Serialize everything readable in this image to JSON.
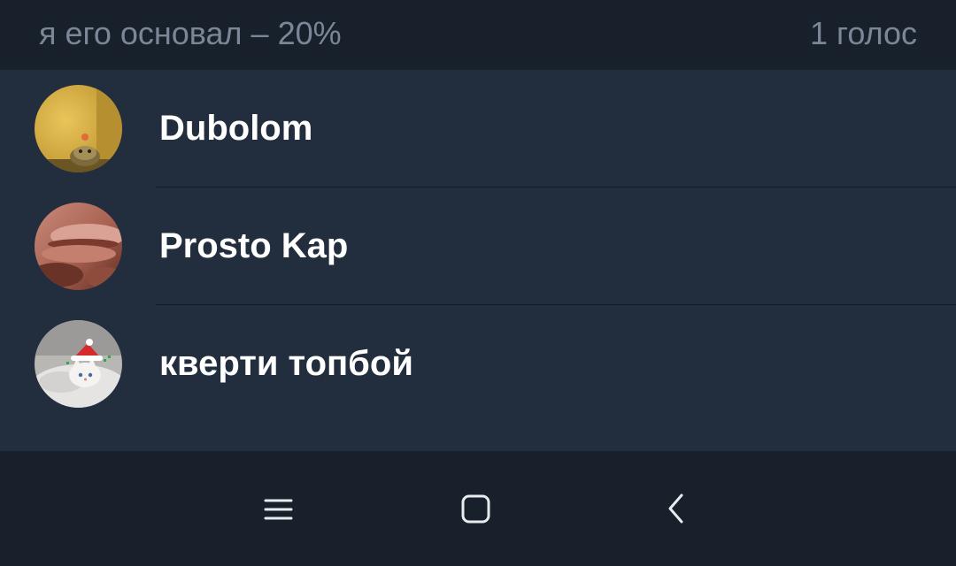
{
  "poll_option": {
    "title": "я его основал – 20%",
    "votes": "1 голос"
  },
  "voters": [
    {
      "name": "Dubolom",
      "avatar": "lizard-avatar"
    },
    {
      "name": "Prosto Kap",
      "avatar": "closeup-avatar"
    },
    {
      "name": "кверти топбой",
      "avatar": "cat-santa-hat-avatar"
    }
  ],
  "navigation": {
    "buttons": [
      "menu-icon",
      "home-icon",
      "back-icon"
    ]
  },
  "colors": {
    "header_bg": "#18202b",
    "list_bg": "#222d3d",
    "secondary_text": "#7b8796",
    "primary_text": "#ffffff"
  }
}
